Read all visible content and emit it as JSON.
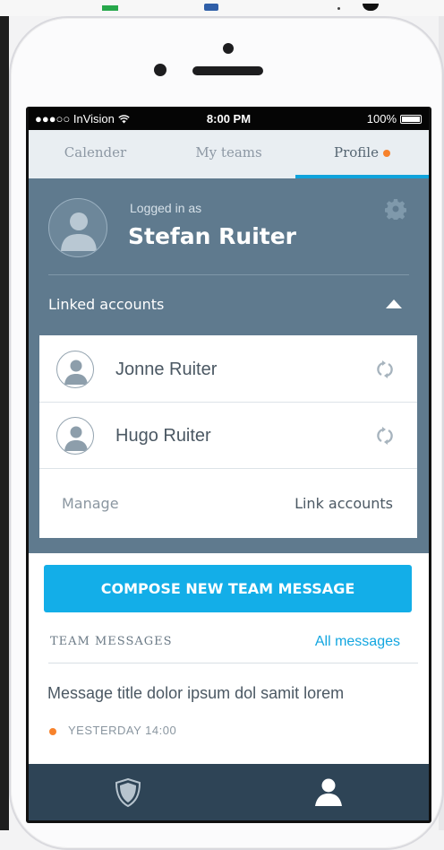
{
  "status_bar": {
    "carrier": "●●●○○ InVision",
    "wifi_icon": "wifi-icon",
    "time": "8:00 PM",
    "battery": "100%"
  },
  "tabs": [
    {
      "label": "Calender",
      "active": false
    },
    {
      "label": "My teams",
      "active": false
    },
    {
      "label": "Profile",
      "active": true,
      "notification": true
    }
  ],
  "profile": {
    "logged_in_label": "Logged in as",
    "name": "Stefan Ruiter",
    "settings_icon": "gear-icon"
  },
  "linked_accounts": {
    "title": "Linked accounts",
    "accounts": [
      {
        "name": "Jonne Ruiter"
      },
      {
        "name": "Hugo Ruiter"
      }
    ],
    "manage_label": "Manage",
    "link_label": "Link accounts"
  },
  "compose_button": "COMPOSE NEW TEAM MESSAGE",
  "team_messages": {
    "title": "TEAM MESSAGES",
    "all_link": "All messages",
    "messages": [
      {
        "title": "Message title dolor ipsum dol samit lorem",
        "time": "YESTERDAY 14:00"
      }
    ]
  },
  "bottom_nav": {
    "items": [
      "shield-icon",
      "user-icon"
    ]
  },
  "colors": {
    "accent_blue": "#13aee8",
    "header_slate": "#5f7a8e",
    "notification_orange": "#f7822c",
    "bottom_nav": "#2e4456"
  }
}
